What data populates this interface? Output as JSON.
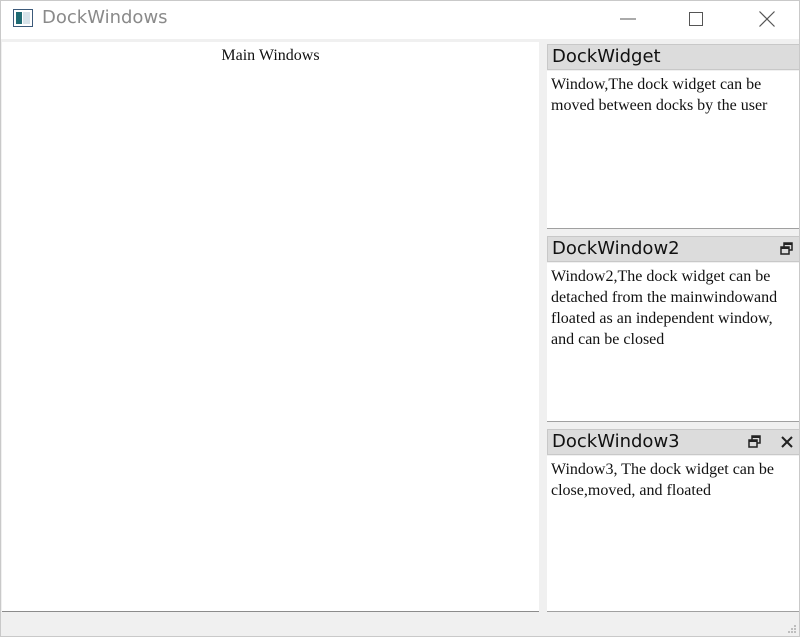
{
  "window": {
    "title": "DockWindows",
    "controls": {
      "minimize": "minimize-icon",
      "maximize": "maximize-icon",
      "close": "close-icon"
    }
  },
  "central": {
    "label": "Main Windows"
  },
  "docks": [
    {
      "title": "DockWidget",
      "text": "Window,The dock widget can be moved between docks by the user",
      "buttons": []
    },
    {
      "title": "DockWindow2",
      "text": "Window2,The dock widget can be detached from the mainwindowand floated as an independent window, and can be closed",
      "buttons": [
        "float-icon"
      ]
    },
    {
      "title": "DockWindow3",
      "text": "Window3, The dock widget can be close,moved, and floated",
      "buttons": [
        "float-icon",
        "close-icon"
      ]
    }
  ],
  "colors": {
    "title_bar": "#ffffff",
    "dock_title_bar": "#dcdcdc",
    "window_background": "#f0f0f0",
    "content_background": "#ffffff"
  }
}
